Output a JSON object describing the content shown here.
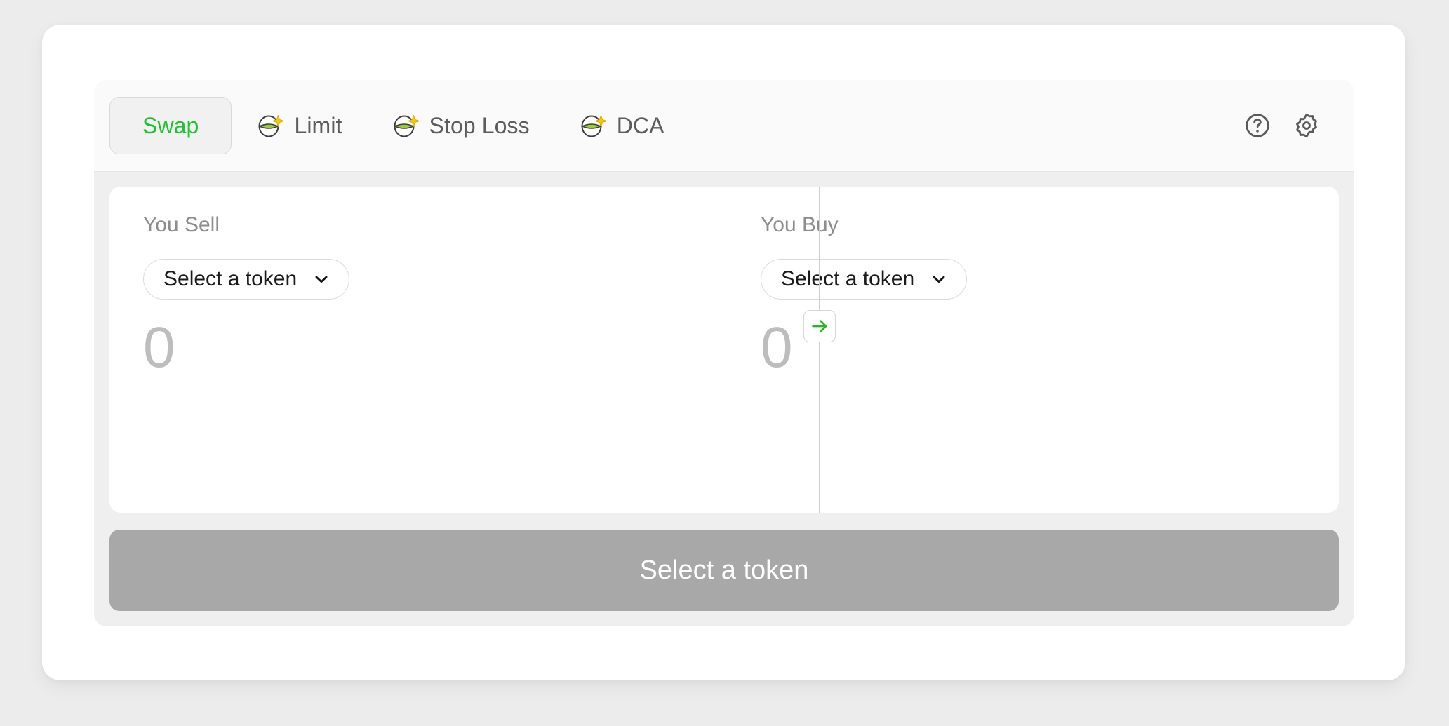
{
  "theme": {
    "page_background": "#ececec",
    "card_background": "#ffffff",
    "panel_background": "#efefef",
    "tabbar_background": "#fafafa",
    "accent_green": "#22c032",
    "arrow_green": "#2bb52b",
    "muted_text": "#8d8d8d",
    "placeholder_text": "#bdbdbd",
    "primary_button_background": "#a8a8a8",
    "primary_button_text": "#ffffff",
    "icon_sparkle_yellow": "#f5c518",
    "icon_bar_green": "#9acd32",
    "icon_outline": "#3d3d3d"
  },
  "tabs": [
    {
      "id": "swap",
      "label": "Swap",
      "active": true,
      "icon": null
    },
    {
      "id": "limit",
      "label": "Limit",
      "active": false,
      "icon": "sparkle-gauge-icon"
    },
    {
      "id": "stop-loss",
      "label": "Stop Loss",
      "active": false,
      "icon": "sparkle-gauge-icon"
    },
    {
      "id": "dca",
      "label": "DCA",
      "active": false,
      "icon": "sparkle-gauge-icon"
    }
  ],
  "tab_actions": [
    {
      "id": "help",
      "icon": "help-circle-icon"
    },
    {
      "id": "settings",
      "icon": "gear-icon"
    }
  ],
  "sell": {
    "label": "You Sell",
    "token_placeholder": "Select a token",
    "amount": "0",
    "chevron": "chevron-down-icon"
  },
  "buy": {
    "label": "You Buy",
    "token_placeholder": "Select a token",
    "amount": "0",
    "chevron": "chevron-down-icon"
  },
  "swap_direction": {
    "icon": "arrow-right-icon"
  },
  "primary_action": {
    "label": "Select a token",
    "disabled": true
  }
}
